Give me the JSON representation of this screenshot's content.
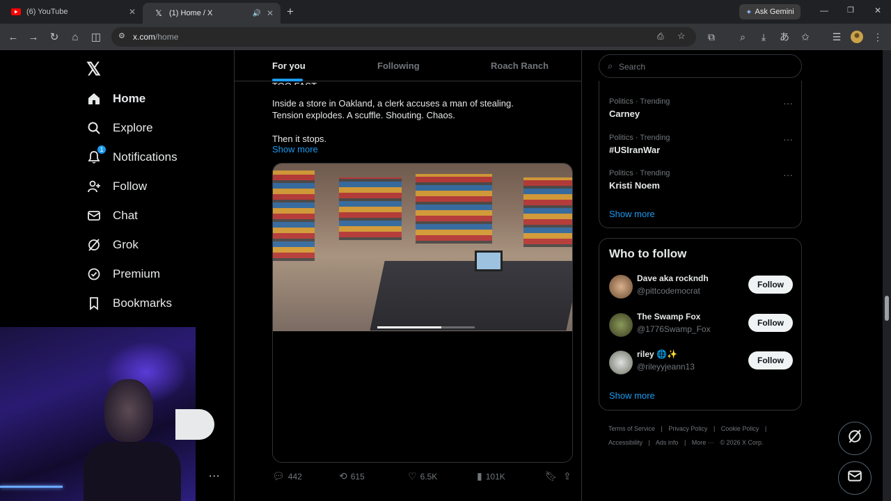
{
  "browser": {
    "tabs": [
      {
        "title": "(6) YouTube",
        "icon": "youtube-icon"
      },
      {
        "title": "(1) Home / X",
        "icon": "x-icon"
      }
    ],
    "new_tab": "+",
    "gemini_label": "Ask Gemini",
    "url_domain": "x.com",
    "url_path": "/home"
  },
  "nav": {
    "items": [
      {
        "label": "Home",
        "icon": "home-icon"
      },
      {
        "label": "Explore",
        "icon": "search-icon"
      },
      {
        "label": "Notifications",
        "icon": "bell-icon",
        "badge": "1"
      },
      {
        "label": "Follow",
        "icon": "add-person-icon"
      },
      {
        "label": "Chat",
        "icon": "mail-icon"
      },
      {
        "label": "Grok",
        "icon": "grok-icon"
      },
      {
        "label": "Premium",
        "icon": "verified-icon"
      },
      {
        "label": "Bookmarks",
        "icon": "bookmark-icon"
      }
    ],
    "more_dots": "..."
  },
  "feed": {
    "tabs": [
      "For you",
      "Following",
      "Roach Ranch"
    ],
    "cut_line": "TOO FAST",
    "post_lines": [
      "Inside a store in Oakland, a clerk accuses a man of stealing.",
      "Tension explodes. A scuffle. Shouting. Chaos.",
      "",
      "Then it stops."
    ],
    "show_more": "Show more",
    "video_progress": 0.66,
    "actions": {
      "replies": "442",
      "reposts": "615",
      "likes": "6.5K",
      "views": "101K"
    }
  },
  "sidebar": {
    "search_placeholder": "Search",
    "trends": [
      {
        "context": "Politics · Trending",
        "name": "Carney"
      },
      {
        "context": "Politics · Trending",
        "name": "#USIranWar"
      },
      {
        "context": "Politics · Trending",
        "name": "Kristi Noem"
      }
    ],
    "trends_show_more": "Show more",
    "who_to_follow_title": "Who to follow",
    "accounts": [
      {
        "name": "Dave aka rockndh",
        "handle": "@pittcodemocrat",
        "button": "Follow"
      },
      {
        "name": "The Swamp Fox",
        "handle": "@1776Swamp_Fox",
        "button": "Follow"
      },
      {
        "name": "riley 🌐✨",
        "handle": "@rileyyjeann13",
        "button": "Follow"
      }
    ],
    "wtf_show_more": "Show more",
    "footer_row1": [
      "Terms of Service",
      "|",
      "Privacy Policy",
      "|",
      "Cookie Policy",
      "|"
    ],
    "footer_row2": [
      "Accessibility",
      "|",
      "Ads info",
      "|",
      "More ···",
      "© 2026 X Corp."
    ]
  }
}
